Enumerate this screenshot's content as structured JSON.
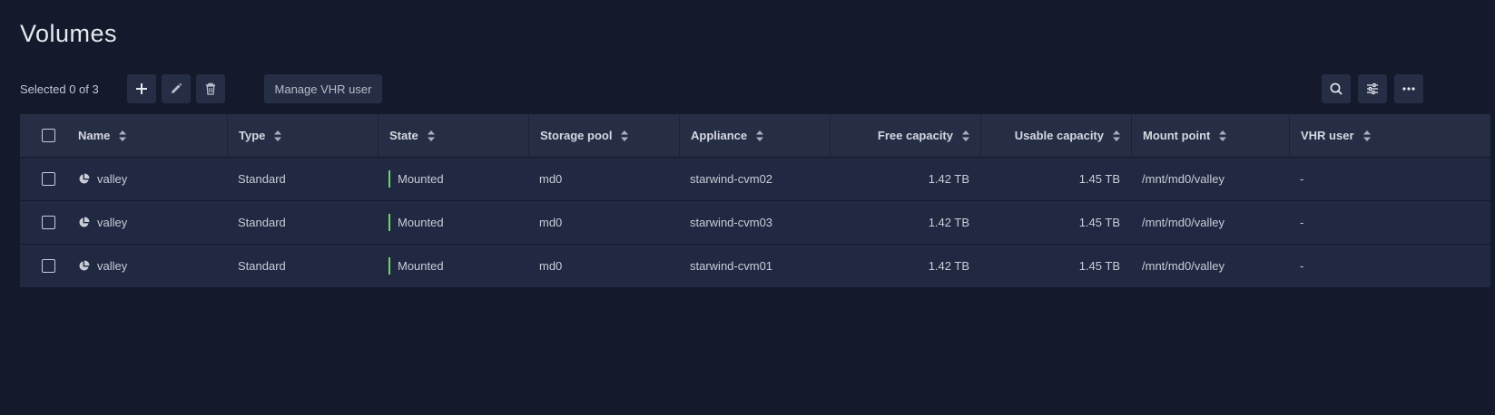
{
  "page": {
    "title": "Volumes"
  },
  "toolbar": {
    "selected_text": "Selected 0 of 3",
    "manage_label": "Manage VHR user",
    "icons": {
      "add": "plus-icon",
      "edit": "pencil-icon",
      "delete": "trash-icon",
      "search": "search-icon",
      "filter": "sliders-icon",
      "more": "more-icon"
    }
  },
  "table": {
    "columns": [
      "Name",
      "Type",
      "State",
      "Storage pool",
      "Appliance",
      "Free capacity",
      "Usable capacity",
      "Mount point",
      "VHR user"
    ],
    "rows": [
      {
        "name": "valley",
        "type": "Standard",
        "state": "Mounted",
        "pool": "md0",
        "appliance": "starwind-cvm02",
        "free": "1.42 TB",
        "usable": "1.45 TB",
        "mount": "/mnt/md0/valley",
        "vhr": "-"
      },
      {
        "name": "valley",
        "type": "Standard",
        "state": "Mounted",
        "pool": "md0",
        "appliance": "starwind-cvm03",
        "free": "1.42 TB",
        "usable": "1.45 TB",
        "mount": "/mnt/md0/valley",
        "vhr": "-"
      },
      {
        "name": "valley",
        "type": "Standard",
        "state": "Mounted",
        "pool": "md0",
        "appliance": "starwind-cvm01",
        "free": "1.42 TB",
        "usable": "1.45 TB",
        "mount": "/mnt/md0/valley",
        "vhr": "-"
      }
    ]
  },
  "colors": {
    "background": "#141a2b",
    "header_bg": "#262e45",
    "row_bg": "#212842",
    "state_mounted": "#6fd46a"
  }
}
